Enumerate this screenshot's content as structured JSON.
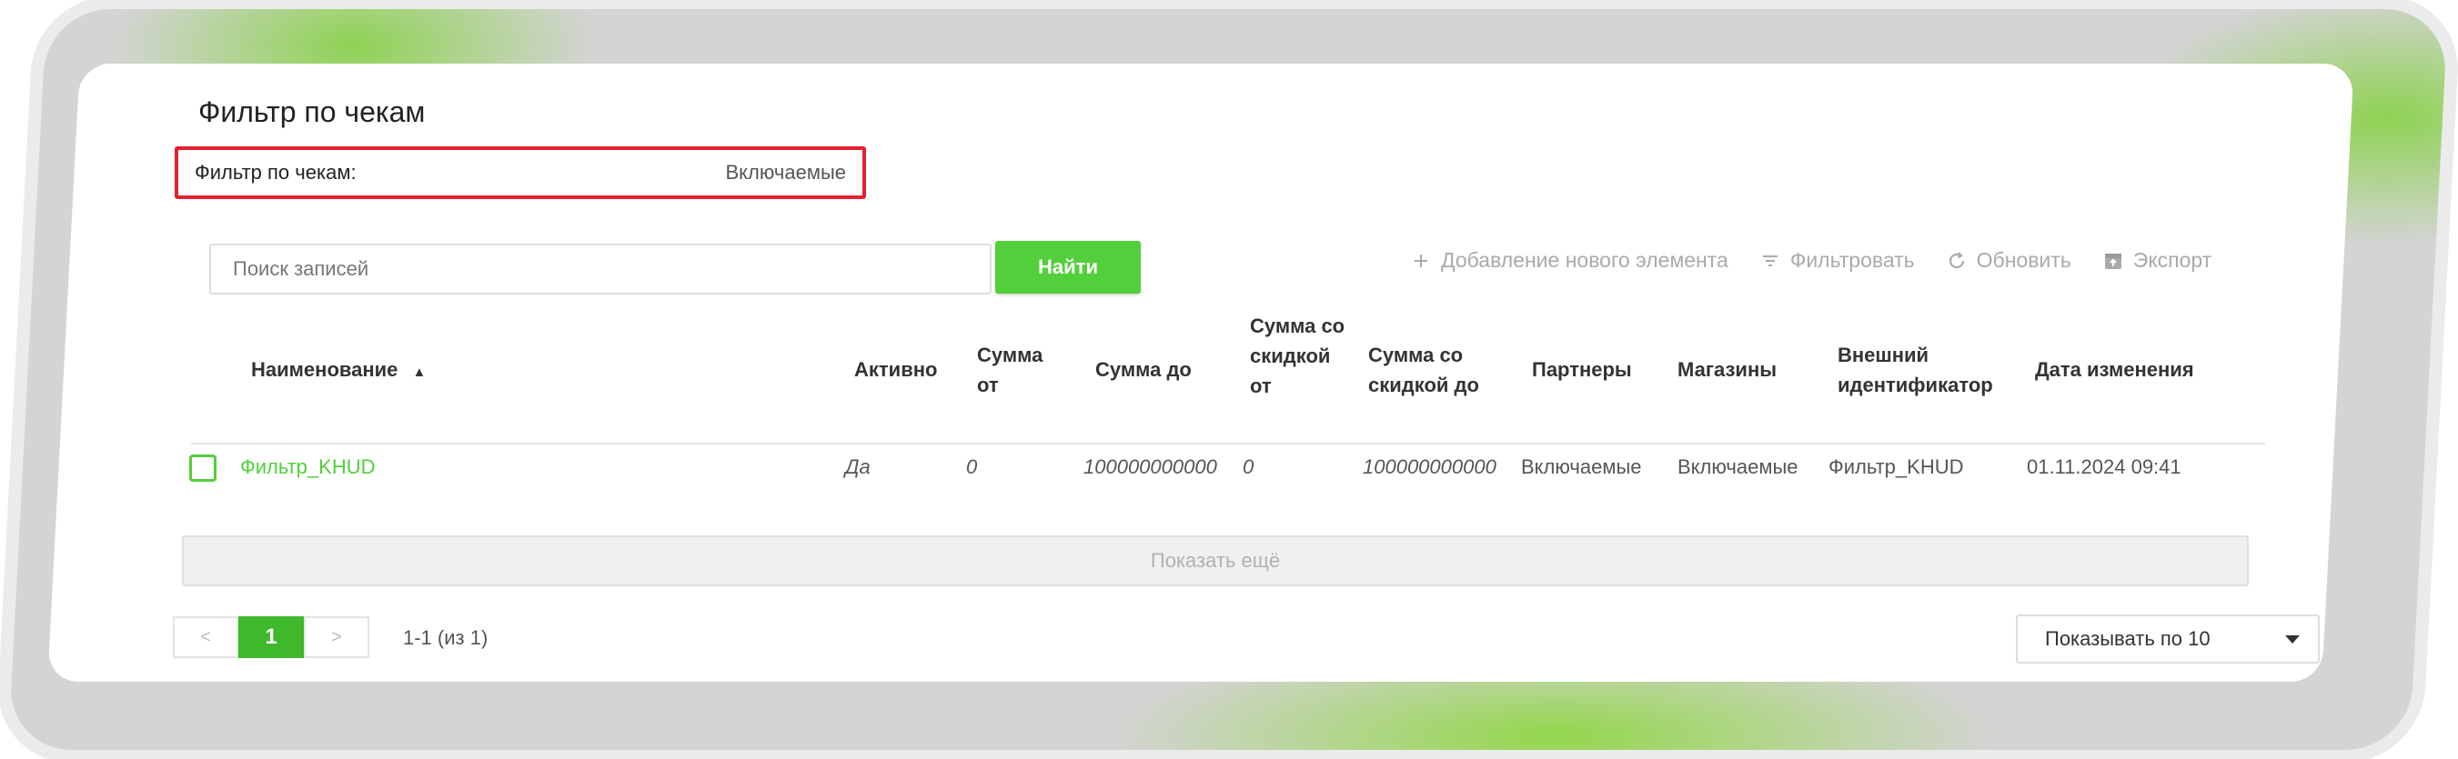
{
  "page": {
    "title": "Фильтр по чекам"
  },
  "filter_summary": {
    "label": "Фильтр по чекам:",
    "value": "Включаемые"
  },
  "search": {
    "placeholder": "Поиск записей",
    "button_label": "Найти"
  },
  "toolbar": {
    "add_label": "Добавление нового элемента",
    "filter_label": "Фильтровать",
    "refresh_label": "Обновить",
    "export_label": "Экспорт"
  },
  "table": {
    "columns": [
      {
        "label": "Наименование",
        "sort": "asc"
      },
      {
        "label": "Активно"
      },
      {
        "label": "Сумма от"
      },
      {
        "label": "Сумма до"
      },
      {
        "label": "Сумма со скидкой от"
      },
      {
        "label": "Сумма со скидкой до"
      },
      {
        "label": "Партнеры"
      },
      {
        "label": "Магазины"
      },
      {
        "label": "Внешний идентификатор"
      },
      {
        "label": "Дата изменения"
      }
    ],
    "rows": [
      {
        "name": "Фильтр_KHUD",
        "active": "Да",
        "sum_from": "0",
        "sum_to": "100000000000",
        "disc_from": "0",
        "disc_to": "100000000000",
        "partners": "Включаемые",
        "stores": "Включаемые",
        "external_id": "Фильтр_KHUD",
        "modified": "01.11.2024 09:41"
      }
    ]
  },
  "show_more_label": "Показать ещё",
  "pagination": {
    "prev": "<",
    "current": "1",
    "next": ">",
    "info": "1-1 (из 1)"
  },
  "page_size": {
    "label": "Показывать по 10"
  },
  "colors": {
    "accent": "#52cf3b",
    "highlight_border": "#e3202f"
  }
}
